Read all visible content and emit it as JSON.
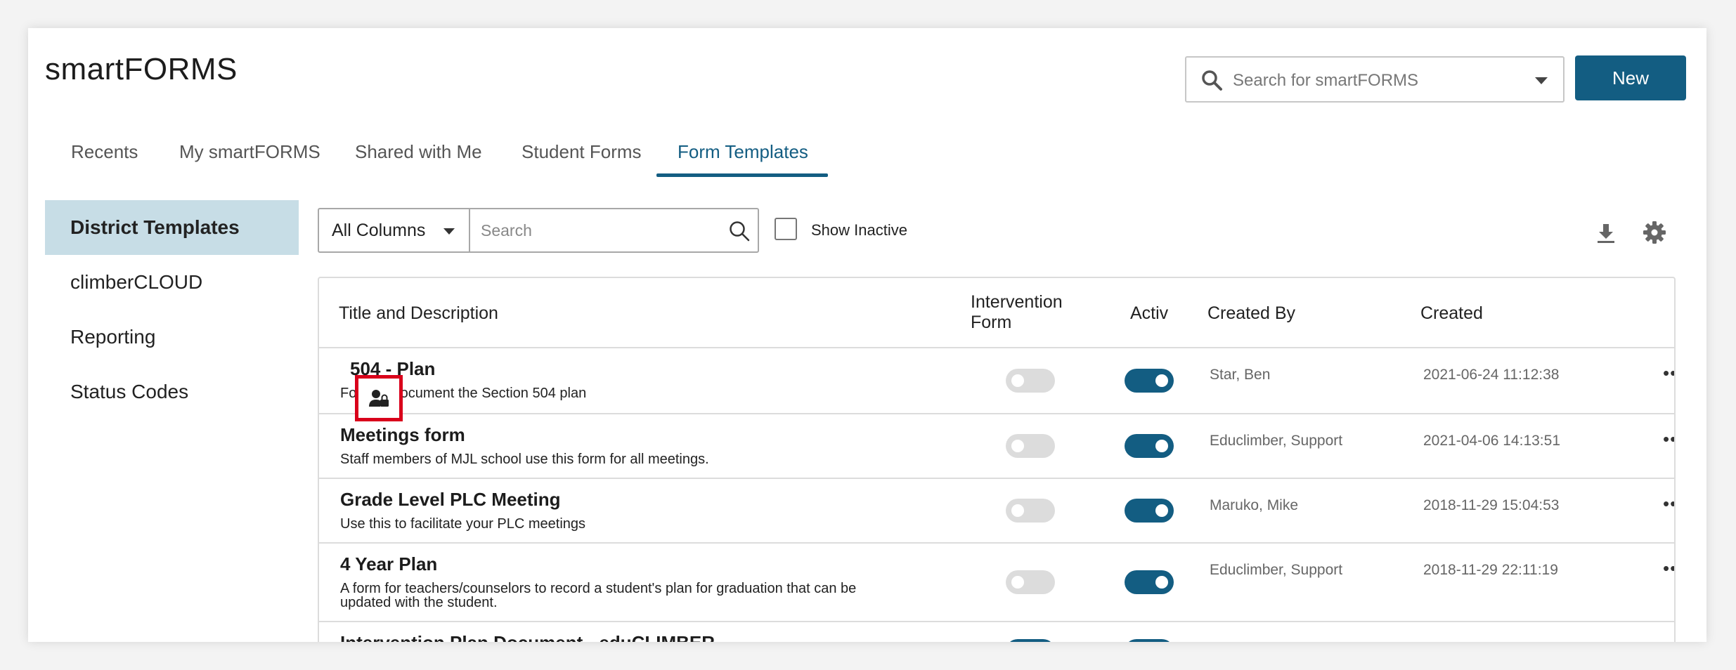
{
  "app": {
    "title": "smartFORMS"
  },
  "search": {
    "placeholder": "Search for smartFORMS",
    "icon": "search-icon"
  },
  "new_button": {
    "label": "New"
  },
  "tabs": [
    {
      "label": "Recents"
    },
    {
      "label": "My smartFORMS"
    },
    {
      "label": "Shared with Me"
    },
    {
      "label": "Student Forms"
    },
    {
      "label": "Form Templates",
      "active": true
    }
  ],
  "sidebar": {
    "items": [
      {
        "label": "District Templates",
        "active": true
      },
      {
        "label": "climberCLOUD"
      },
      {
        "label": "Reporting"
      },
      {
        "label": "Status Codes"
      }
    ]
  },
  "filter": {
    "column_select": "All Columns",
    "search_placeholder": "Search",
    "show_inactive_label": "Show Inactive",
    "show_inactive_checked": false
  },
  "table": {
    "headers": {
      "title": "Title and Description",
      "intervention_line1": "Intervention",
      "intervention_line2": "Form",
      "active": "Activ",
      "created_by": "Created By",
      "created": "Created"
    },
    "rows": [
      {
        "title": "504 - Plan",
        "desc": "Form to document the Section 504 plan",
        "intervention": false,
        "active": true,
        "created_by": "Star, Ben",
        "created": "2021-06-24 11:12:38",
        "more": "•••."
      },
      {
        "title": "Meetings form",
        "desc": "Staff members of MJL school use this form for all meetings.",
        "intervention": false,
        "active": true,
        "created_by": "Educlimber, Support",
        "created": "2021-04-06 14:13:51",
        "more": "•••."
      },
      {
        "title": "Grade Level PLC Meeting",
        "desc": "Use this to facilitate your PLC meetings",
        "intervention": false,
        "active": true,
        "created_by": "Maruko, Mike",
        "created": "2018-11-29 15:04:53",
        "more": "•••."
      },
      {
        "title": "4 Year Plan",
        "desc": "A form for teachers/counselors to record a student's plan for graduation that can be updated with the student.",
        "intervention": false,
        "active": true,
        "created_by": "Educlimber, Support",
        "created": "2018-11-29 22:11:19",
        "more": "•••."
      },
      {
        "title": "Intervention Plan Document - eduCLIMBER",
        "desc": "",
        "intervention": true,
        "active": true,
        "created_by": "",
        "created": "",
        "more": ""
      }
    ]
  },
  "colors": {
    "brand": "#135d82",
    "highlight": "#d9001b",
    "sidebar_active": "#c7dde6"
  }
}
